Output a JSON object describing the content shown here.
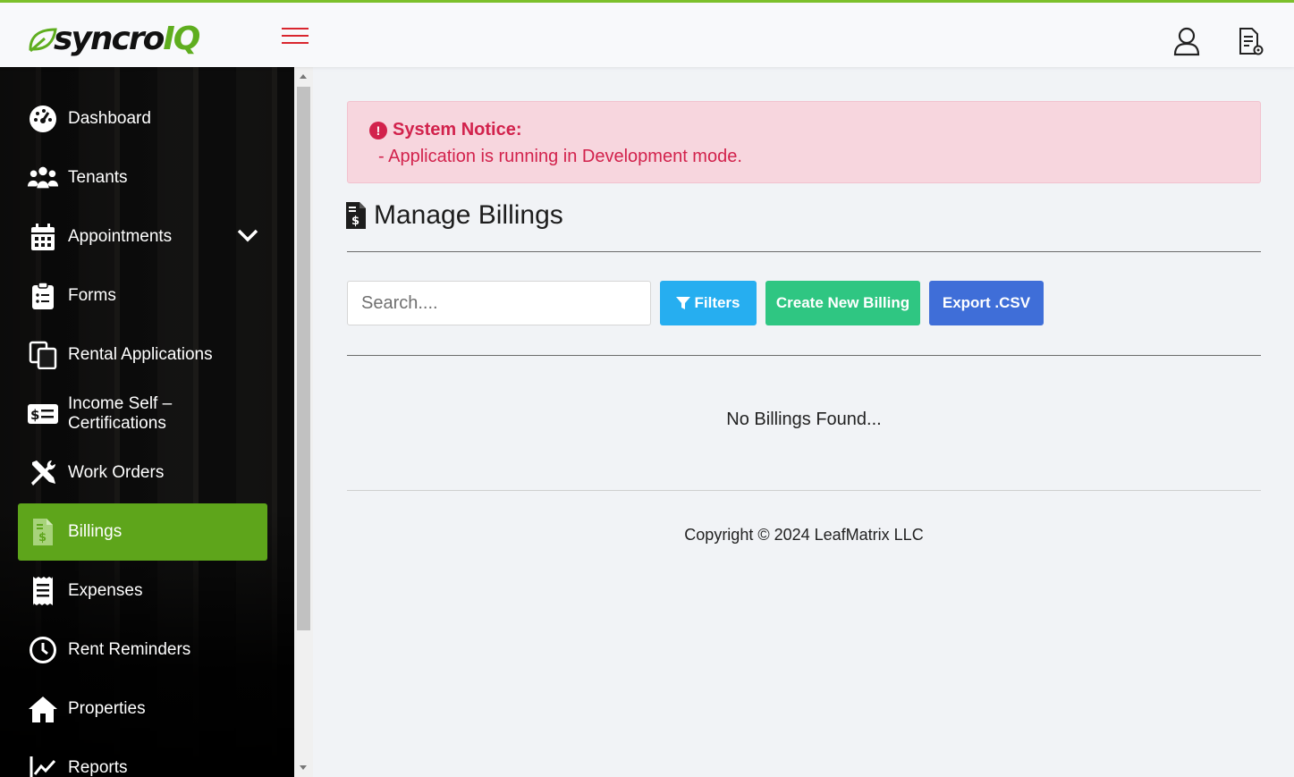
{
  "brand": {
    "name_main": "syncro",
    "name_accent": "IQ",
    "accent_color": "#5fae1f",
    "top_border_color": "#7cc02b"
  },
  "header": {
    "menu_icon": "hamburger-icon",
    "user_icon": "user-icon",
    "doc_icon": "document-settings-icon"
  },
  "sidebar": {
    "items": [
      {
        "label": "Dashboard",
        "icon": "dashboard-icon"
      },
      {
        "label": "Tenants",
        "icon": "users-icon"
      },
      {
        "label": "Appointments",
        "icon": "calendar-icon",
        "has_dropdown": true
      },
      {
        "label": "Forms",
        "icon": "clipboard-icon"
      },
      {
        "label": "Rental Applications",
        "icon": "copy-icon"
      },
      {
        "label": "Income Self – Certifications",
        "icon": "money-bill-icon"
      },
      {
        "label": "Work Orders",
        "icon": "tools-icon"
      },
      {
        "label": "Billings",
        "icon": "invoice-icon",
        "active": true
      },
      {
        "label": "Expenses",
        "icon": "receipt-icon"
      },
      {
        "label": "Rent Reminders",
        "icon": "clock-icon"
      },
      {
        "label": "Properties",
        "icon": "home-icon"
      },
      {
        "label": "Reports",
        "icon": "chart-line-icon"
      }
    ],
    "active_color": "#5ea51b"
  },
  "notice": {
    "title": "System Notice:",
    "message": "- Application is running in Development mode.",
    "color": "#d2224c",
    "background": "#f7d6de"
  },
  "page": {
    "title": "Manage Billings",
    "icon": "file-invoice-dollar-icon"
  },
  "toolbar": {
    "search_placeholder": "Search....",
    "search_value": "",
    "filters_label": "Filters",
    "create_label": "Create New Billing",
    "export_label": "Export .CSV",
    "filters_color": "#26aef0",
    "create_color": "#2fc682",
    "export_color": "#3f6ed8"
  },
  "empty_state": "No Billings Found...",
  "footer": {
    "copyright": "Copyright © 2024 LeafMatrix LLC"
  }
}
